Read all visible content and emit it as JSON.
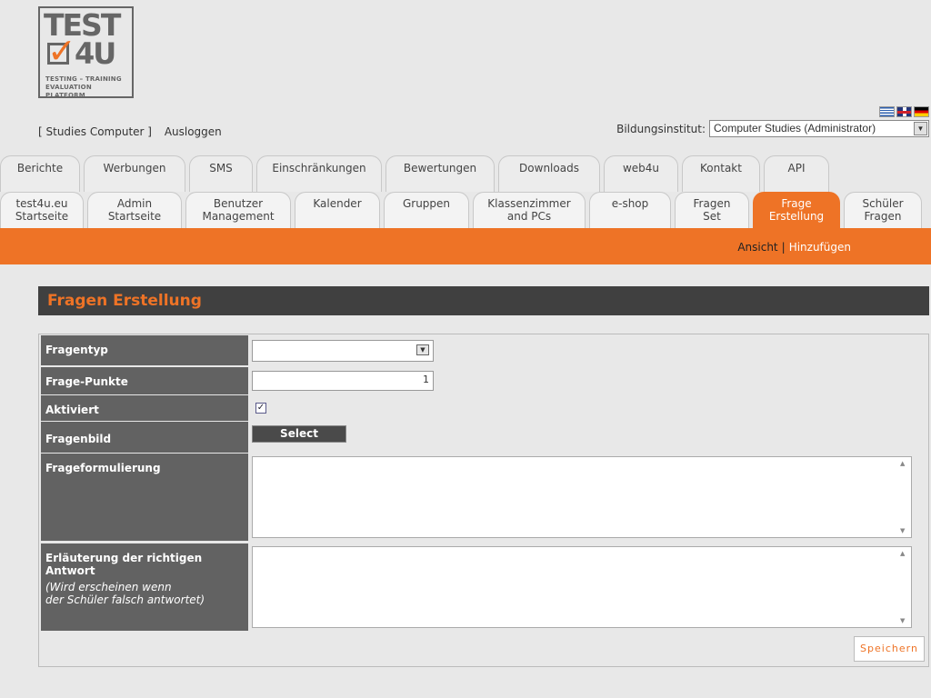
{
  "logo": {
    "line1": "TEST",
    "line2": "4U",
    "check": "✓",
    "tagline1": "TESTING – TRAINING",
    "tagline2": "EVALUATION PLATFORM"
  },
  "user": {
    "name": "[ Studies Computer ]",
    "logout": "Ausloggen"
  },
  "institute": {
    "label": "Bildungsinstitut:",
    "value": "Computer Studies (Administrator)"
  },
  "tabs_row1": [
    {
      "label": "Berichte",
      "w": 88
    },
    {
      "label": "Werbungen",
      "w": 112
    },
    {
      "label": "SMS",
      "w": 70
    },
    {
      "label": "Einschränkungen",
      "w": 138
    },
    {
      "label": "Bewertungen",
      "w": 120
    },
    {
      "label": "Downloads",
      "w": 112
    },
    {
      "label": "web4u",
      "w": 82
    },
    {
      "label": "Kontakt",
      "w": 86
    },
    {
      "label": "API",
      "w": 72
    }
  ],
  "tabs_row2": [
    {
      "label": "test4u.eu\nStartseite",
      "w": 92
    },
    {
      "label": "Admin\nStartseite",
      "w": 104
    },
    {
      "label": "Benutzer\nManagement",
      "w": 116
    },
    {
      "label": "Kalender",
      "w": 94
    },
    {
      "label": "Gruppen",
      "w": 94
    },
    {
      "label": "Klassenzimmer\nand PCs",
      "w": 124
    },
    {
      "label": "e-shop",
      "w": 90
    },
    {
      "label": "Fragen\nSet",
      "w": 82
    },
    {
      "label": "Frage\nErstellung",
      "w": 96,
      "active": true
    },
    {
      "label": "Schüler\nFragen",
      "w": 86
    }
  ],
  "subnav": {
    "view": "Ansicht",
    "separator": "|",
    "add": "Hinzufügen"
  },
  "panel": {
    "title": "Fragen Erstellung"
  },
  "form": {
    "type_label": "Fragentyp",
    "type_value": "",
    "points_label": "Frage-Punkte",
    "points_value": "1",
    "active_label": "Aktiviert",
    "active_checked": true,
    "image_label": "Fragenbild",
    "image_button": "Select",
    "question_label": "Frageformulierung",
    "explain_label": "Erläuterung der richtigen Antwort",
    "explain_hint1": "(Wird erscheinen wenn",
    "explain_hint2": "der Schüler falsch antwortet)",
    "save": "Speichern"
  }
}
